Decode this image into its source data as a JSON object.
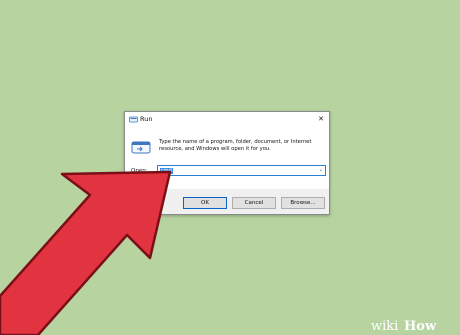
{
  "dialog": {
    "title": "Run",
    "close_icon": "close-icon",
    "message": "Type the name of a program, folder, document, or Internet resource, and Windows will open it for you.",
    "open_label": "Open:",
    "open_value": "cmd",
    "buttons": {
      "ok": "OK",
      "cancel": "Cancel",
      "browse": "Browse..."
    }
  },
  "watermark": {
    "text_wiki": "wiki",
    "text_how": "How"
  },
  "colors": {
    "background": "#b7d3a0",
    "arrow": "#e23340",
    "arrow_outline": "#7a0f18",
    "selection": "#3a8ee6",
    "focus_border": "#2f7fd2"
  }
}
